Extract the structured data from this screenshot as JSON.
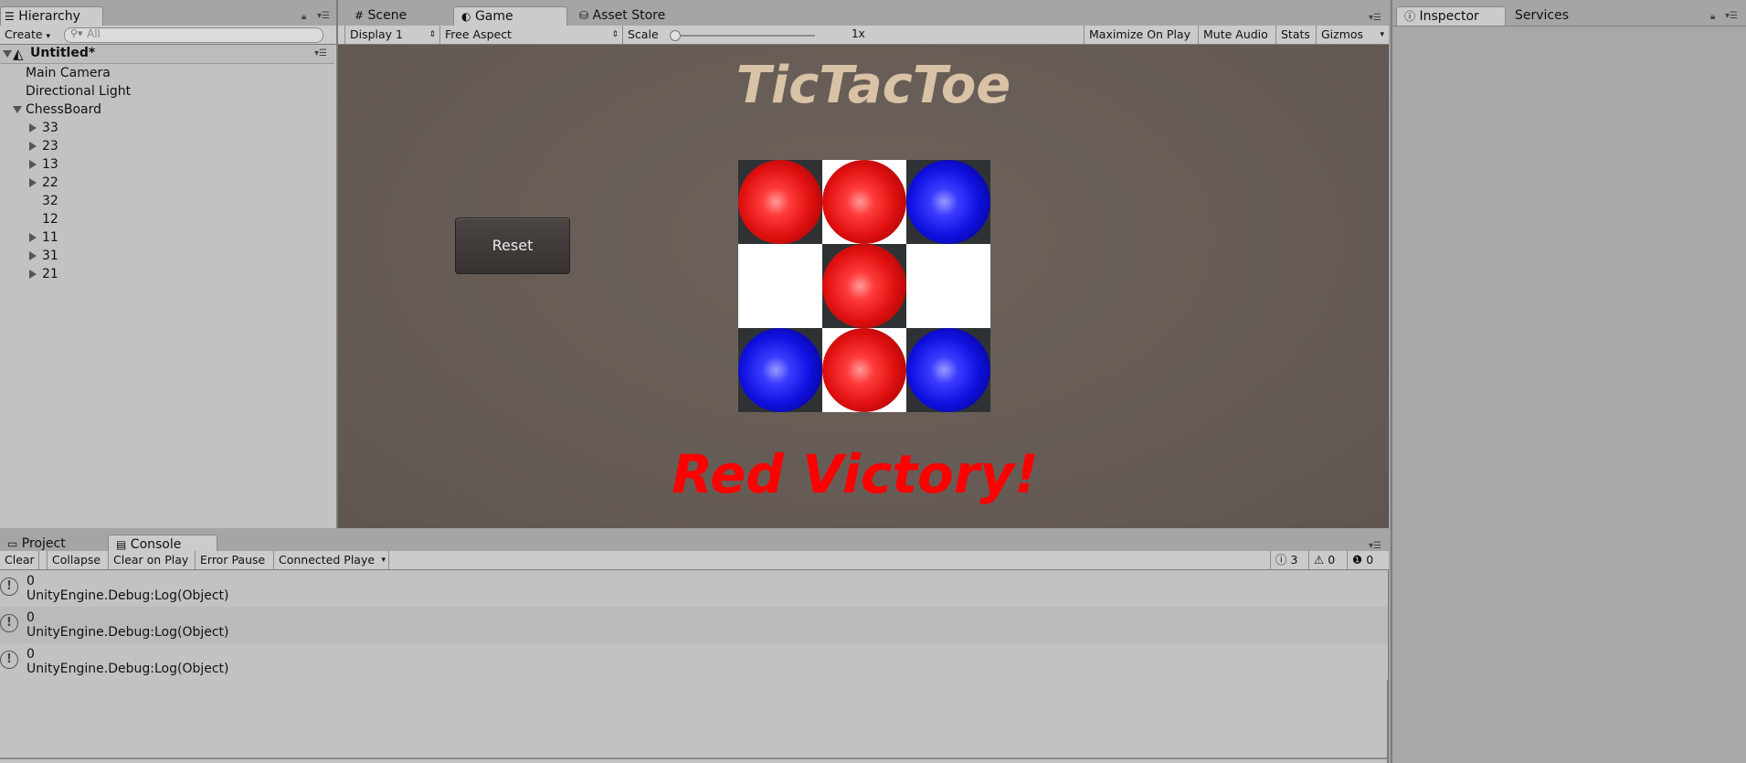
{
  "hierarchy": {
    "tab_label": "Hierarchy",
    "create_label": "Create",
    "search_placeholder": "All",
    "scene_name": "Untitled*",
    "items": [
      {
        "label": "Main Camera"
      },
      {
        "label": "Directional Light"
      },
      {
        "label": "ChessBoard"
      },
      {
        "label": "33"
      },
      {
        "label": "23"
      },
      {
        "label": "13"
      },
      {
        "label": "22"
      },
      {
        "label": "32"
      },
      {
        "label": "12"
      },
      {
        "label": "11"
      },
      {
        "label": "31"
      },
      {
        "label": "21"
      }
    ]
  },
  "center_tabs": {
    "scene": "Scene",
    "game": "Game",
    "asset_store": "Asset Store"
  },
  "game_toolbar": {
    "display": "Display 1",
    "aspect": "Free Aspect",
    "scale_label": "Scale",
    "scale_value": "1x",
    "scale_fraction": 0.0,
    "maximize": "Maximize On Play",
    "mute": "Mute Audio",
    "stats": "Stats",
    "gizmos": "Gizmos"
  },
  "game": {
    "title": "TicTacToe",
    "reset_label": "Reset",
    "result": "Red Victory!",
    "board": [
      [
        "red",
        "red",
        "blue"
      ],
      [
        "",
        "red",
        ""
      ],
      [
        "blue",
        "red",
        "blue"
      ]
    ],
    "colors": {
      "background": "#685e57",
      "title": "#d9c2a6",
      "result": "#ff0000",
      "red_piece": "#e01010",
      "blue_piece": "#1010e0"
    }
  },
  "inspector": {
    "tab_label": "Inspector",
    "services_label": "Services"
  },
  "bottom_tabs": {
    "project": "Project",
    "console": "Console"
  },
  "console": {
    "clear": "Clear",
    "collapse": "Collapse",
    "clear_on_play": "Clear on Play",
    "error_pause": "Error Pause",
    "connected_player": "Connected Playe",
    "count_info": "3",
    "count_warning": "0",
    "count_error": "0",
    "entries": [
      {
        "value": "0",
        "source": "UnityEngine.Debug:Log(Object)"
      },
      {
        "value": "0",
        "source": "UnityEngine.Debug:Log(Object)"
      },
      {
        "value": "0",
        "source": "UnityEngine.Debug:Log(Object)"
      }
    ]
  }
}
